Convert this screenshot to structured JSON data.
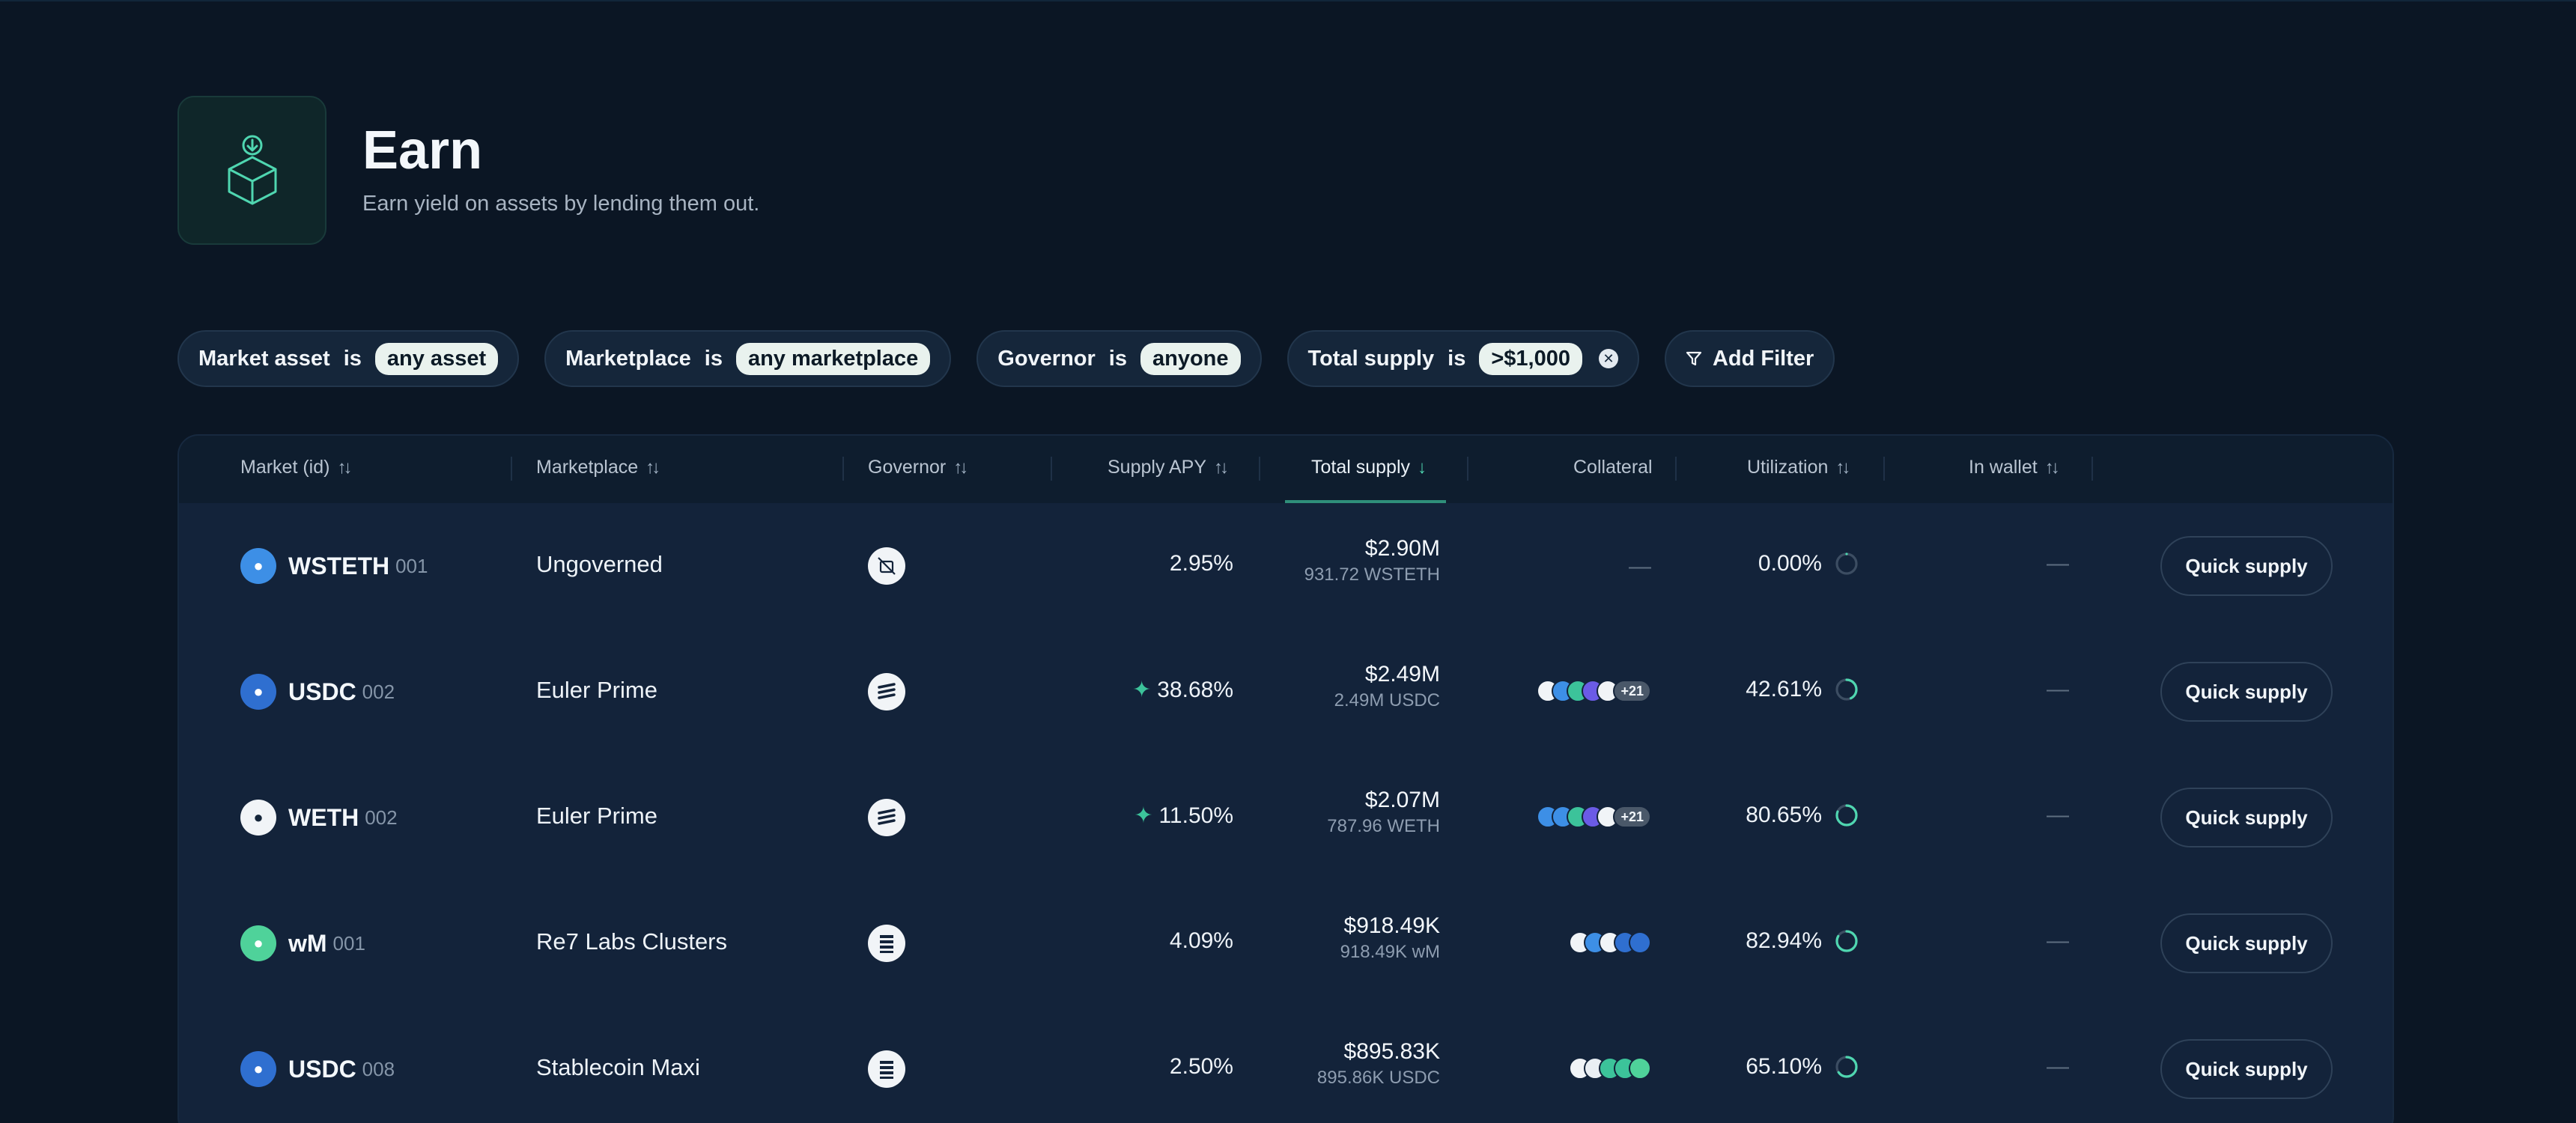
{
  "header": {
    "title": "Earn",
    "subtitle": "Earn yield on assets by lending them out.",
    "icon": "box-deposit-icon"
  },
  "filters": [
    {
      "field": "Market asset",
      "op": "is",
      "value": "any asset",
      "clearable": false
    },
    {
      "field": "Marketplace",
      "op": "is",
      "value": "any marketplace",
      "clearable": false
    },
    {
      "field": "Governor",
      "op": "is",
      "value": "anyone",
      "clearable": false
    },
    {
      "field": "Total supply",
      "op": "is",
      "value": ">$1,000",
      "clearable": true
    }
  ],
  "add_filter_label": "Add Filter",
  "columns": {
    "market": "Market (id)",
    "marketplace": "Marketplace",
    "governor": "Governor",
    "supply_apy": "Supply APY",
    "total_supply": "Total supply",
    "collateral": "Collateral",
    "utilization": "Utilization",
    "in_wallet": "In wallet"
  },
  "active_sort": "total_supply",
  "rows": [
    {
      "asset": "WSTETH",
      "id": "001",
      "icon_color": "#3d8fe6",
      "marketplace": "Ungoverned",
      "governor_icon": "ungoverned-icon",
      "apy": "2.95%",
      "boosted": false,
      "supply_usd": "$2.90M",
      "supply_native": "931.72 WSTETH",
      "collateral": "—",
      "collateral_more": "",
      "utilization": "0.00%",
      "util_value": 0.0,
      "wallet": "—",
      "action": "Quick supply"
    },
    {
      "asset": "USDC",
      "id": "002",
      "icon_color": "#2f6fd0",
      "marketplace": "Euler Prime",
      "governor_icon": "euler-icon",
      "apy": "38.68%",
      "boosted": true,
      "supply_usd": "$2.49M",
      "supply_native": "2.49M USDC",
      "collateral": "coins",
      "collateral_more": "+21",
      "utilization": "42.61%",
      "util_value": 0.4261,
      "wallet": "—",
      "action": "Quick supply"
    },
    {
      "asset": "WETH",
      "id": "002",
      "icon_color": "#f1f4f7",
      "marketplace": "Euler Prime",
      "governor_icon": "euler-icon",
      "apy": "11.50%",
      "boosted": true,
      "supply_usd": "$2.07M",
      "supply_native": "787.96 WETH",
      "collateral": "coins",
      "collateral_more": "+21",
      "utilization": "80.65%",
      "util_value": 0.8065,
      "wallet": "—",
      "action": "Quick supply"
    },
    {
      "asset": "wM",
      "id": "001",
      "icon_color": "#4fd29a",
      "marketplace": "Re7 Labs Clusters",
      "governor_icon": "re7-icon",
      "apy": "4.09%",
      "boosted": false,
      "supply_usd": "$918.49K",
      "supply_native": "918.49K wM",
      "collateral": "coins",
      "collateral_more": "",
      "utilization": "82.94%",
      "util_value": 0.8294,
      "wallet": "—",
      "action": "Quick supply"
    },
    {
      "asset": "USDC",
      "id": "008",
      "icon_color": "#2f6fd0",
      "marketplace": "Stablecoin Maxi",
      "governor_icon": "re7-icon",
      "apy": "2.50%",
      "boosted": false,
      "supply_usd": "$895.83K",
      "supply_native": "895.86K USDC",
      "collateral": "coins",
      "collateral_more": "",
      "utilization": "65.10%",
      "util_value": 0.651,
      "wallet": "—",
      "action": "Quick supply"
    }
  ],
  "colors": {
    "accent": "#2f8f7a",
    "background": "#0b1624",
    "table": "#13233a"
  }
}
